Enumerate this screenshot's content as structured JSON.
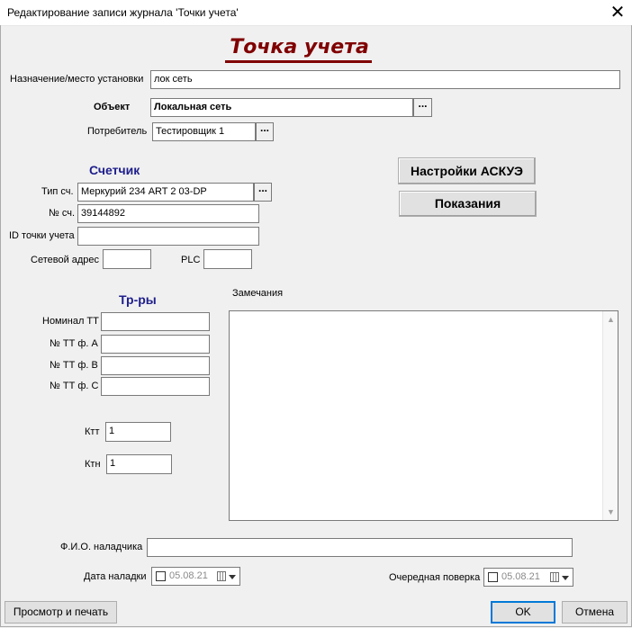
{
  "window": {
    "title": "Редактирование записи журнала 'Точки учета'",
    "close": "✕"
  },
  "heading": "Точка учета",
  "purpose": {
    "label": "Назначение/место установки",
    "value": "лок сеть"
  },
  "object": {
    "label": "Объект",
    "value": "Локальная сеть",
    "button": "..."
  },
  "consumer": {
    "label": "Потребитель",
    "value": "Тестировщик 1",
    "button": "..."
  },
  "meter": {
    "section": "Счетчик",
    "type_label": "Тип сч.",
    "type_value": "Меркурий 234 ART 2 03-DP",
    "type_button": "...",
    "number_label": "№ сч.",
    "number_value": "39144892",
    "point_id_label": "ID точки учета",
    "point_id_value": "",
    "net_addr_label": "Сетевой адрес",
    "net_addr_value": "",
    "plc_label": "PLC",
    "plc_value": ""
  },
  "buttons": {
    "askue": "Настройки АСКУЭ",
    "readings": "Показания",
    "preview": "Просмотр и печать",
    "ok": "OK",
    "cancel": "Отмена"
  },
  "transformers": {
    "section": "Тр-ры",
    "nominal_label": "Номинал ТТ",
    "nominal_value": "",
    "tt_a_label": "№ ТТ ф. А",
    "tt_a_value": "",
    "tt_b_label": "№ ТТ ф. В",
    "tt_b_value": "",
    "tt_c_label": "№ ТТ ф. С",
    "tt_c_value": "",
    "ktt_label": "Ктт",
    "ktt_value": "1",
    "ktn_label": "Ктн",
    "ktn_value": "1"
  },
  "remarks": {
    "label": "Замечания",
    "value": ""
  },
  "adjuster": {
    "label": "Ф.И.О. наладчика",
    "value": ""
  },
  "adjust_date": {
    "label": "Дата наладки",
    "value": "05.08.21"
  },
  "next_check": {
    "label": "Очередная поверка",
    "value": "05.08.21"
  }
}
